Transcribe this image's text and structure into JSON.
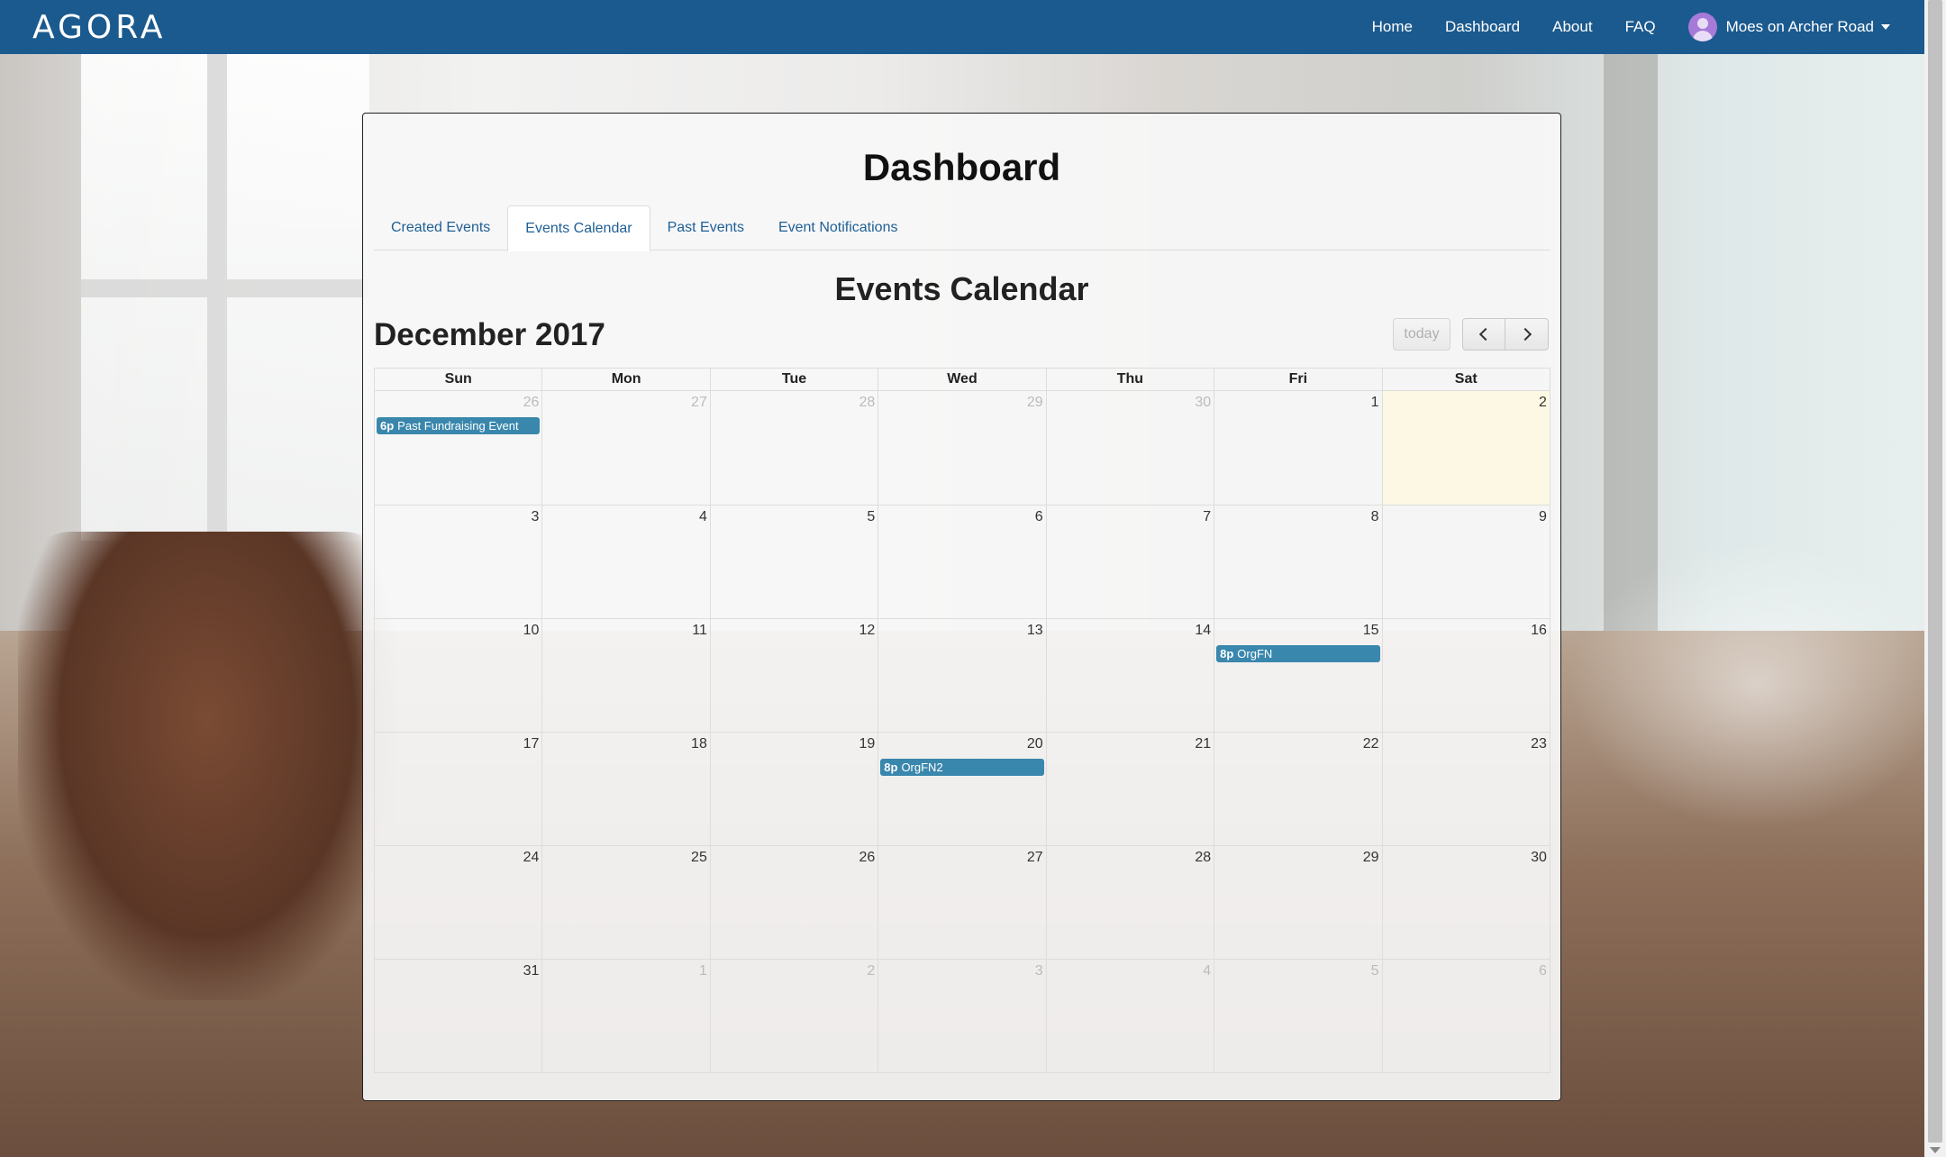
{
  "brand": {
    "name": "AGORA"
  },
  "nav": {
    "links": [
      "Home",
      "Dashboard",
      "About",
      "FAQ"
    ],
    "user": "Moes on Archer Road"
  },
  "page": {
    "title": "Dashboard"
  },
  "tabs": [
    "Created Events",
    "Events Calendar",
    "Past Events",
    "Event Notifications"
  ],
  "active_tab": "Events Calendar",
  "calendar": {
    "section_title": "Events Calendar",
    "month_title": "December 2017",
    "today_label": "today",
    "weekdays": [
      "Sun",
      "Mon",
      "Tue",
      "Wed",
      "Thu",
      "Fri",
      "Sat"
    ],
    "weeks": [
      [
        {
          "d": "26",
          "other": true,
          "event": {
            "time": "6p",
            "title": "Past Fundraising Event"
          }
        },
        {
          "d": "27",
          "other": true
        },
        {
          "d": "28",
          "other": true
        },
        {
          "d": "29",
          "other": true
        },
        {
          "d": "30",
          "other": true
        },
        {
          "d": "1"
        },
        {
          "d": "2",
          "today": true
        }
      ],
      [
        {
          "d": "3"
        },
        {
          "d": "4"
        },
        {
          "d": "5"
        },
        {
          "d": "6"
        },
        {
          "d": "7"
        },
        {
          "d": "8"
        },
        {
          "d": "9"
        }
      ],
      [
        {
          "d": "10"
        },
        {
          "d": "11"
        },
        {
          "d": "12"
        },
        {
          "d": "13"
        },
        {
          "d": "14"
        },
        {
          "d": "15",
          "event": {
            "time": "8p",
            "title": "OrgFN"
          }
        },
        {
          "d": "16"
        }
      ],
      [
        {
          "d": "17"
        },
        {
          "d": "18"
        },
        {
          "d": "19"
        },
        {
          "d": "20",
          "event": {
            "time": "8p",
            "title": "OrgFN2"
          }
        },
        {
          "d": "21"
        },
        {
          "d": "22"
        },
        {
          "d": "23"
        }
      ],
      [
        {
          "d": "24"
        },
        {
          "d": "25"
        },
        {
          "d": "26"
        },
        {
          "d": "27"
        },
        {
          "d": "28"
        },
        {
          "d": "29"
        },
        {
          "d": "30"
        }
      ],
      [
        {
          "d": "31"
        },
        {
          "d": "1",
          "other": true
        },
        {
          "d": "2",
          "other": true
        },
        {
          "d": "3",
          "other": true
        },
        {
          "d": "4",
          "other": true
        },
        {
          "d": "5",
          "other": true
        },
        {
          "d": "6",
          "other": true
        }
      ]
    ]
  },
  "colors": {
    "navbar": "#1b5a8e",
    "event": "#3a87ad",
    "today_highlight": "#fcf8e3",
    "link": "#1f5f95"
  }
}
